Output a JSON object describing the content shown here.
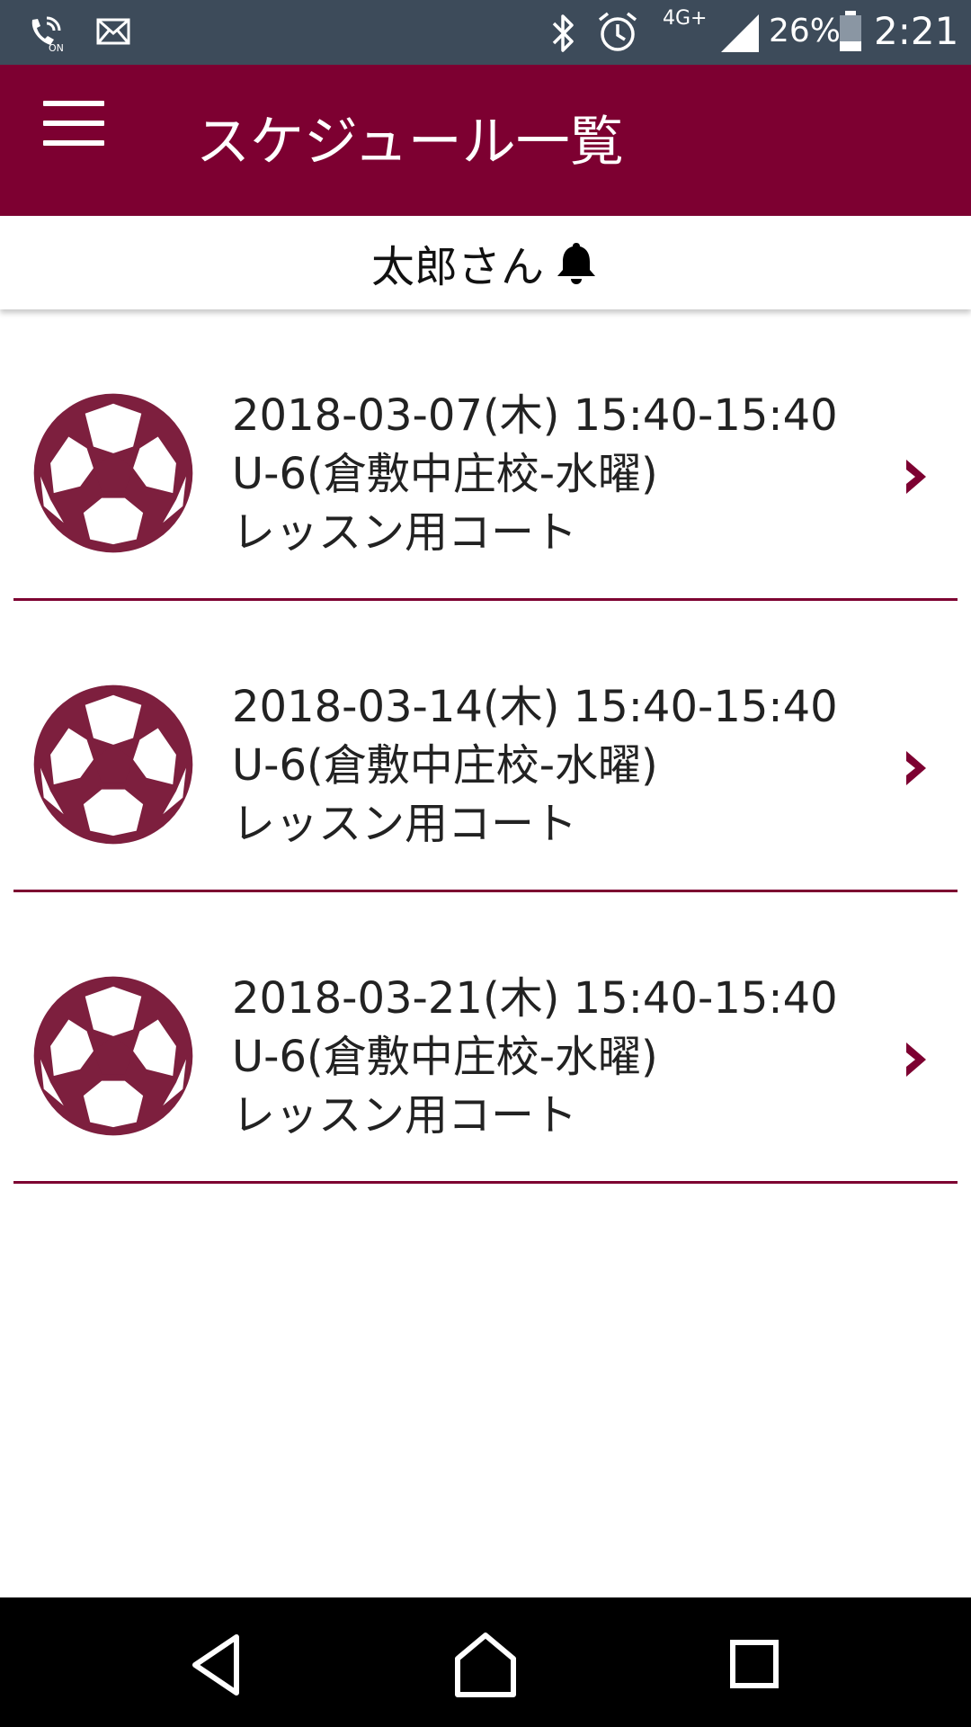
{
  "status_bar": {
    "network": "4G+",
    "battery": "26%",
    "time": "2:21"
  },
  "app_bar": {
    "title": "スケジュール一覧"
  },
  "user_header": {
    "name": "太郎さん"
  },
  "schedule": [
    {
      "datetime": "2018-03-07(木) 15:40-15:40",
      "class": "U-6(倉敷中庄校-水曜)",
      "court": "レッスン用コート"
    },
    {
      "datetime": "2018-03-14(木) 15:40-15:40",
      "class": "U-6(倉敷中庄校-水曜)",
      "court": "レッスン用コート"
    },
    {
      "datetime": "2018-03-21(木) 15:40-15:40",
      "class": "U-6(倉敷中庄校-水曜)",
      "court": "レッスン用コート"
    }
  ],
  "icons": {
    "menu": "hamburger-menu-icon",
    "bell": "bell-icon",
    "list_item": "soccer-ball-icon",
    "chevron": "chevron-right-icon",
    "nav_back": "back-triangle-icon",
    "nav_home": "home-icon",
    "nav_recents": "recents-square-icon"
  },
  "colors": {
    "brand": "#7d0031",
    "status_bar": "#3d4b5a",
    "nav_bar": "#000000"
  }
}
